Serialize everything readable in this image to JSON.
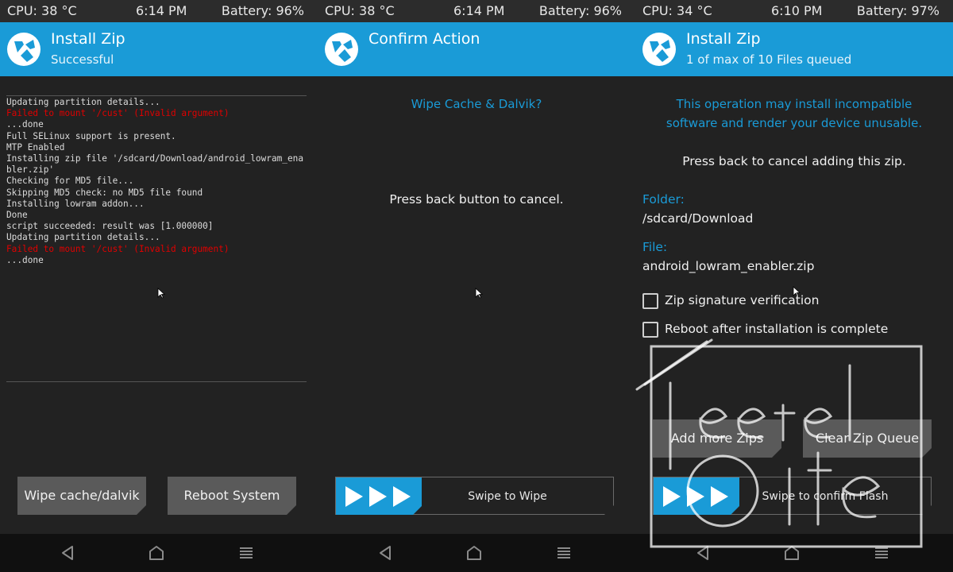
{
  "panels": [
    {
      "status": {
        "cpu": "CPU: 38 °C",
        "time": "6:14 PM",
        "battery": "Battery: 96%"
      },
      "header": {
        "title": "Install Zip",
        "subtitle": "Successful"
      },
      "console": [
        {
          "text": "Updating partition details...",
          "error": false
        },
        {
          "text": "Failed to mount '/cust' (Invalid argument)",
          "error": true
        },
        {
          "text": "...done",
          "error": false
        },
        {
          "text": "Full SELinux support is present.",
          "error": false
        },
        {
          "text": "MTP Enabled",
          "error": false
        },
        {
          "text": "Installing zip file '/sdcard/Download/android_lowram_enabler.zip'",
          "error": false
        },
        {
          "text": "Checking for MD5 file...",
          "error": false
        },
        {
          "text": "Skipping MD5 check: no MD5 file found",
          "error": false
        },
        {
          "text": "Installing lowram addon...",
          "error": false
        },
        {
          "text": "Done",
          "error": false
        },
        {
          "text": "script succeeded: result was [1.000000]",
          "error": false
        },
        {
          "text": "Updating partition details...",
          "error": false
        },
        {
          "text": "Failed to mount '/cust' (Invalid argument)",
          "error": true
        },
        {
          "text": "...done",
          "error": false
        }
      ],
      "buttons": {
        "wipe": "Wipe cache/dalvik",
        "reboot": "Reboot System"
      }
    },
    {
      "status": {
        "cpu": "CPU: 38 °C",
        "time": "6:14 PM",
        "battery": "Battery: 96%"
      },
      "header": {
        "title": "Confirm Action"
      },
      "question": "Wipe Cache & Dalvik?",
      "cancel_hint": "Press back button to cancel.",
      "swipe_label": "Swipe to Wipe"
    },
    {
      "status": {
        "cpu": "CPU: 34 °C",
        "time": "6:10 PM",
        "battery": "Battery: 97%"
      },
      "header": {
        "title": "Install Zip",
        "subtitle": "1 of max of 10 Files queued"
      },
      "warning_line1": "This operation may install incompatible",
      "warning_line2": "software and render your device unusable.",
      "cancel_hint": "Press back to cancel adding this zip.",
      "folder_label": "Folder:",
      "folder_value": "/sdcard/Download",
      "file_label": "File:",
      "file_value": "android_lowram_enabler.zip",
      "checkboxes": [
        {
          "label": "Zip signature verification",
          "checked": false
        },
        {
          "label": "Reboot after installation is complete",
          "checked": false
        }
      ],
      "buttons": {
        "add": "Add more Zips",
        "clear": "Clear Zip Queue"
      },
      "swipe_label": "Swipe to confirm Flash"
    }
  ],
  "colors": {
    "accent": "#1a9bd7",
    "error": "#e00000",
    "background": "#222222"
  },
  "icons": [
    "teamwin-logo-icon",
    "back-icon",
    "home-icon",
    "menu-icon",
    "play-arrow-icon",
    "mouse-cursor-icon"
  ]
}
